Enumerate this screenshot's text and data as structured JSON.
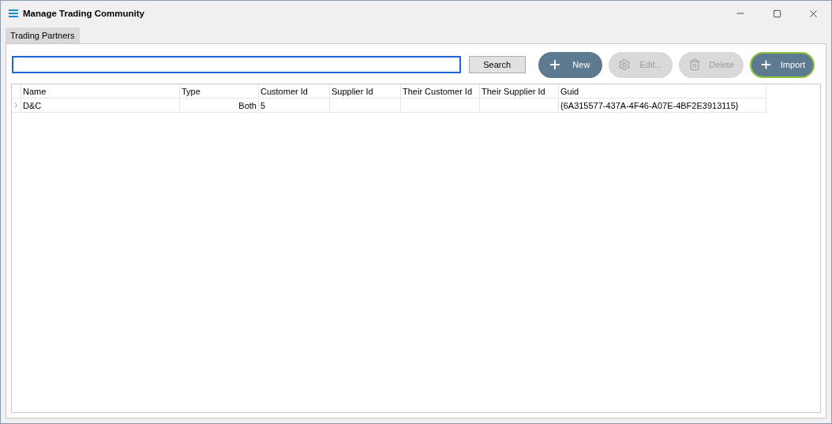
{
  "window": {
    "title": "Manage Trading Community"
  },
  "tabs": [
    {
      "label": "Trading Partners",
      "selected": true
    }
  ],
  "search": {
    "focused": true,
    "button": "Search"
  },
  "actions": [
    {
      "label": "New",
      "kind": "add",
      "disabled": false,
      "focused": false
    },
    {
      "label": "Edit...",
      "kind": "edit",
      "disabled": true,
      "focused": false
    },
    {
      "label": "Delete",
      "kind": "delete",
      "disabled": true,
      "focused": false
    },
    {
      "label": "Import",
      "kind": "add",
      "disabled": false,
      "focused": true
    }
  ],
  "table": {
    "columns": [
      "Name",
      "Type",
      "Customer Id",
      "Supplier Id",
      "Their Customer Id",
      "Their Supplier Id",
      "Guid"
    ],
    "rows": [
      {
        "current": true,
        "cells": [
          "D&C",
          "Both",
          "5",
          "",
          "",
          "",
          "{6A315577-437A-4F46-A07E-4BF2E3913115}"
        ]
      }
    ]
  }
}
